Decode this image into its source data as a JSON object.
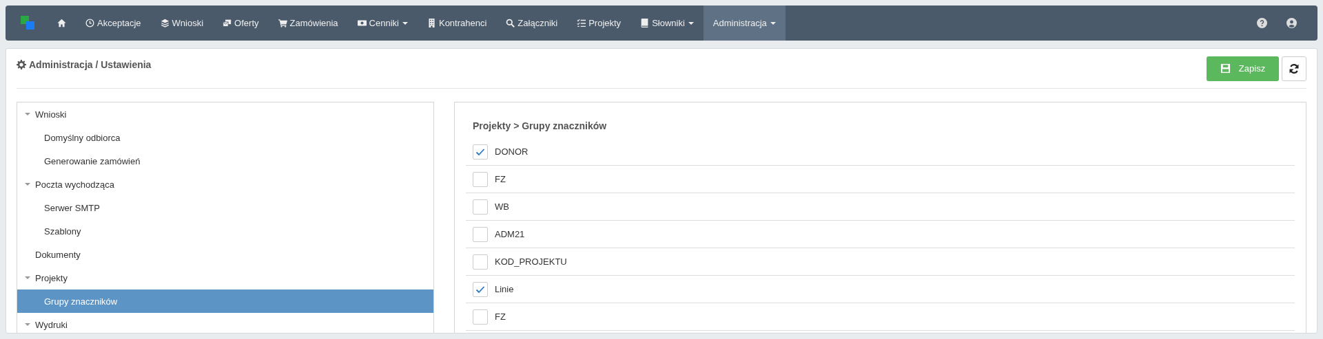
{
  "navbar": {
    "items": [
      {
        "selected": false,
        "dropdown": false
      },
      {
        "label": "Akceptacje",
        "selected": false,
        "dropdown": false
      },
      {
        "label": "Wnioski",
        "selected": false,
        "dropdown": false
      },
      {
        "label": "Oferty",
        "selected": false,
        "dropdown": false
      },
      {
        "label": "Zamówienia",
        "selected": false,
        "dropdown": false
      },
      {
        "label": "Cenniki",
        "selected": false,
        "dropdown": true
      },
      {
        "label": "Kontrahenci",
        "selected": false,
        "dropdown": false
      },
      {
        "label": "Załączniki",
        "selected": false,
        "dropdown": false
      },
      {
        "label": "Projekty",
        "selected": false,
        "dropdown": false
      },
      {
        "label": "Słowniki",
        "selected": false,
        "dropdown": true
      },
      {
        "label": "Administracja",
        "selected": true,
        "dropdown": true
      }
    ]
  },
  "page": {
    "title": "Administracja / Ustawienia",
    "save_button": "Zapisz"
  },
  "tree": [
    {
      "label": "Wnioski",
      "expanded": true,
      "selected": false,
      "children": [
        {
          "label": "Domyślny odbiorca",
          "selected": false
        },
        {
          "label": "Generowanie zamówień",
          "selected": false
        }
      ]
    },
    {
      "label": "Poczta wychodząca",
      "expanded": true,
      "selected": false,
      "children": [
        {
          "label": "Serwer SMTP",
          "selected": false
        },
        {
          "label": "Szablony",
          "selected": false
        }
      ]
    },
    {
      "label": "Dokumenty",
      "selected": false
    },
    {
      "label": "Projekty",
      "expanded": true,
      "selected": false,
      "children": [
        {
          "label": "Grupy znaczników",
          "selected": true
        }
      ]
    },
    {
      "label": "Wydruki",
      "expanded": true,
      "selected": false
    }
  ],
  "settings": {
    "title": "Projekty > Grupy znaczników",
    "items": [
      {
        "label": "DONOR",
        "checked": true
      },
      {
        "label": "FZ",
        "checked": false
      },
      {
        "label": "WB",
        "checked": false
      },
      {
        "label": "ADM21",
        "checked": false
      },
      {
        "label": "KOD_PROJEKTU",
        "checked": false
      },
      {
        "label": "Linie",
        "checked": true
      },
      {
        "label": "FZ",
        "checked": false
      }
    ]
  }
}
